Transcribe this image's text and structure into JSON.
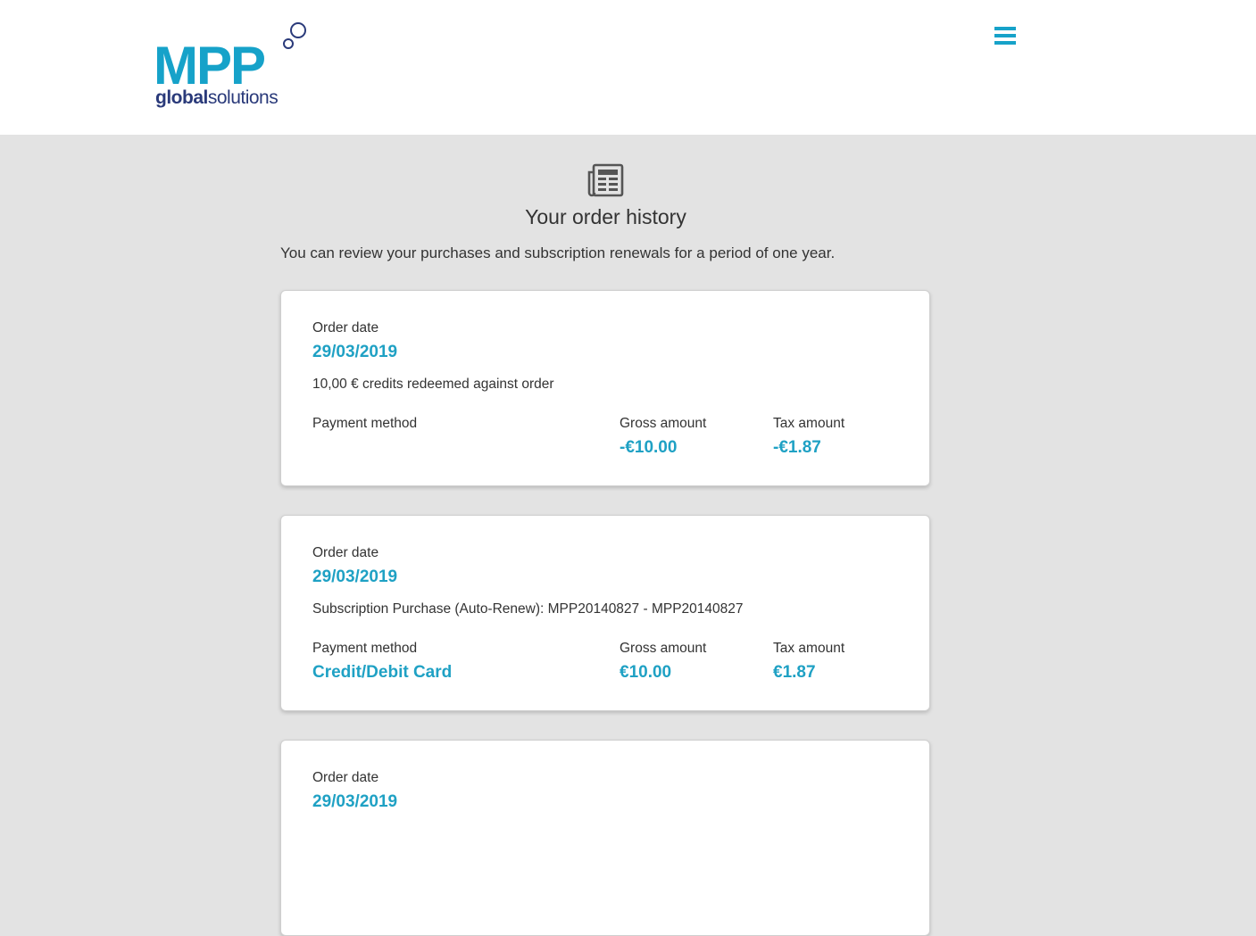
{
  "header": {
    "logo": {
      "brand": "MPP",
      "sub_bold": "global",
      "sub_regular": "solutions"
    },
    "menu_icon": "hamburger-menu-icon"
  },
  "main": {
    "page_icon": "newspaper-icon",
    "title": "Your order history",
    "intro": "You can review your purchases and subscription renewals for a period of one year.",
    "orders": [
      {
        "order_date_label": "Order date",
        "order_date": "29/03/2019",
        "description": "10,00 € credits redeemed against order",
        "payment_method_label": "Payment method",
        "payment_method": "",
        "gross_amount_label": "Gross amount",
        "gross_amount": "-€10.00",
        "tax_amount_label": "Tax amount",
        "tax_amount": "-€1.87"
      },
      {
        "order_date_label": "Order date",
        "order_date": "29/03/2019",
        "description": "Subscription Purchase (Auto-Renew): MPP20140827 - MPP20140827",
        "payment_method_label": "Payment method",
        "payment_method": "Credit/Debit Card",
        "gross_amount_label": "Gross amount",
        "gross_amount": "€10.00",
        "tax_amount_label": "Tax amount",
        "tax_amount": "€1.87"
      },
      {
        "order_date_label": "Order date",
        "order_date": "29/03/2019"
      }
    ]
  },
  "colors": {
    "accent": "#1fa1c4",
    "logo_navy": "#2a3a7a",
    "page_background": "#e3e3e3",
    "card_background": "#ffffff"
  }
}
